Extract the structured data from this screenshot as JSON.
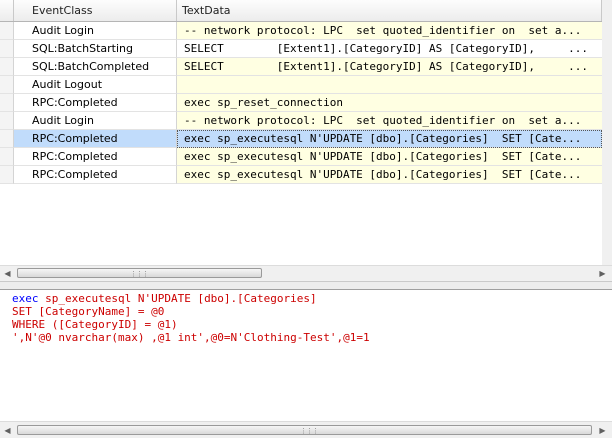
{
  "columns": {
    "event_class": "EventClass",
    "text_data": "TextData"
  },
  "rows": [
    {
      "event": "Audit Login",
      "text": "-- network protocol: LPC  set quoted_identifier on  set a...",
      "style": "yellow"
    },
    {
      "event": "SQL:BatchStarting",
      "text": "SELECT        [Extent1].[CategoryID] AS [CategoryID],     ...",
      "style": "white"
    },
    {
      "event": "SQL:BatchCompleted",
      "text": "SELECT        [Extent1].[CategoryID] AS [CategoryID],     ...",
      "style": "yellow"
    },
    {
      "event": "Audit Logout",
      "text": "",
      "style": "yellow"
    },
    {
      "event": "RPC:Completed",
      "text": "exec sp_reset_connection",
      "style": "yellow"
    },
    {
      "event": "Audit Login",
      "text": "-- network protocol: LPC  set quoted_identifier on  set a...",
      "style": "yellow"
    },
    {
      "event": "RPC:Completed",
      "text": "exec sp_executesql N'UPDATE [dbo].[Categories]  SET [Cate...",
      "style": "selected"
    },
    {
      "event": "RPC:Completed",
      "text": "exec sp_executesql N'UPDATE [dbo].[Categories]  SET [Cate...",
      "style": "yellow"
    },
    {
      "event": "RPC:Completed",
      "text": "exec sp_executesql N'UPDATE [dbo].[Categories]  SET [Cate...",
      "style": "yellow"
    }
  ],
  "detail": {
    "line1_kw": "exec",
    "line1_rest": " sp_executesql N'UPDATE [dbo].[Categories]",
    "line2": "SET [CategoryName] = @0",
    "line3": "WHERE ([CategoryID] = @1)",
    "line4": "',N'@0 nvarchar(max) ,@1 int',@0=N'Clothing-Test',@1=1"
  },
  "icons": {
    "scroll_left": "scroll-left-arrow-icon",
    "scroll_right": "scroll-right-arrow-icon",
    "thumb_grip": "thumb-grip-icon"
  },
  "colors": {
    "selected_row": "#c1dcfb",
    "textdata_bg": "#ffffe2",
    "code_text": "#cc0000",
    "keyword": "#0000ff"
  }
}
